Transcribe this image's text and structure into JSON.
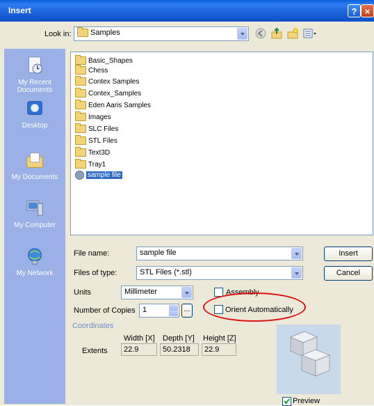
{
  "window": {
    "title": "Insert"
  },
  "lookin": {
    "label": "Look in:",
    "value": "Samples",
    "toolbar_icons": [
      "back-icon",
      "up-folder-icon",
      "new-folder-icon",
      "views-menu-icon"
    ]
  },
  "places": [
    {
      "label": "My Recent Documents",
      "icon": "recent-documents-icon"
    },
    {
      "label": "Desktop",
      "icon": "desktop-icon"
    },
    {
      "label": "My Documents",
      "icon": "my-documents-icon"
    },
    {
      "label": "My Computer",
      "icon": "my-computer-icon"
    },
    {
      "label": "My Network",
      "icon": "my-network-icon"
    }
  ],
  "files": [
    {
      "name": "Basic_Shapes",
      "type": "folder"
    },
    {
      "name": "Chess",
      "type": "folder"
    },
    {
      "name": "Contex Samples",
      "type": "folder"
    },
    {
      "name": "Contex_Samples",
      "type": "folder"
    },
    {
      "name": "Eden Aaris Samples",
      "type": "folder"
    },
    {
      "name": "Images",
      "type": "folder"
    },
    {
      "name": "SLC Files",
      "type": "folder"
    },
    {
      "name": "STL Files",
      "type": "folder"
    },
    {
      "name": "Text3D",
      "type": "folder"
    },
    {
      "name": "Tray1",
      "type": "folder"
    },
    {
      "name": "sample file",
      "type": "file",
      "selected": true
    }
  ],
  "filename": {
    "label": "File name:",
    "value": "sample file"
  },
  "filetype": {
    "label": "Files of type:",
    "value": "STL Files (*.stl)"
  },
  "buttons": {
    "insert": "Insert",
    "cancel": "Cancel",
    "browse": "..."
  },
  "units": {
    "label": "Units",
    "value": "Millimeter"
  },
  "assembly": {
    "label": "Assembly",
    "checked": false
  },
  "copies": {
    "label": "Number of Copies",
    "value": "1"
  },
  "orient": {
    "label": "Orient Automatically",
    "checked": false
  },
  "coordinates_label": "Coordinates",
  "extents": {
    "label": "Extents",
    "headers": [
      "Width [X]",
      "Depth [Y]",
      "Height [Z]"
    ],
    "values": [
      "22.9",
      "50.2318",
      "22.9"
    ]
  },
  "preview": {
    "label": "Preview",
    "checked": true
  },
  "colors": {
    "title_bar": "#0a5fdc",
    "places_bar": "#9bb0e6",
    "selection": "#316ac5",
    "highlight_ellipse": "#e01010"
  }
}
